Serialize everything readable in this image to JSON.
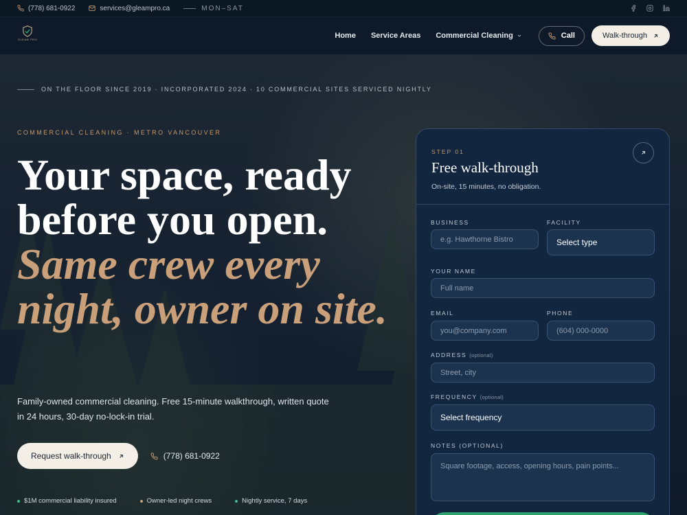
{
  "topbar": {
    "phone": "(778) 681-0922",
    "email": "services@gleampro.ca",
    "hours": "MON–SAT",
    "social_icons": [
      "facebook-icon",
      "instagram-icon",
      "linkedin-icon"
    ]
  },
  "nav": {
    "logo_text": "GLEAM PRO",
    "links": [
      "Home",
      "Service Areas",
      "Commercial Cleaning"
    ],
    "call_label": "Call",
    "walkthrough_label": "Walk-through"
  },
  "hero": {
    "since_line": "ON THE FLOOR SINCE 2019 · INCORPORATED 2024 · 10 COMMERCIAL SITES SERVICED NIGHTLY",
    "eyebrow": "COMMERCIAL CLEANING · METRO VANCOUVER",
    "headline_line1": "Your space, ready",
    "headline_line2": "before you open.",
    "headline_accent": "Same crew every night, owner on site.",
    "lead": "Family-owned commercial cleaning. Free 15-minute walkthrough, written quote in 24 hours, 30-day no-lock-in trial.",
    "cta_label": "Request walk-through",
    "cta_phone": "(778) 681-0922",
    "badges": [
      {
        "text": "$1M commercial liability insured",
        "color": "#3fbf86"
      },
      {
        "text": "Owner-led night crews",
        "color": "#c9a07a"
      },
      {
        "text": "Nightly service, 7 days",
        "color": "#3fbf86"
      }
    ]
  },
  "form": {
    "step": "STEP 01",
    "title": "Free walk-through",
    "subtitle": "On-site, 15 minutes, no obligation.",
    "business_label": "BUSINESS",
    "business_placeholder": "e.g. Hawthorne Bistro",
    "facility_label": "FACILITY",
    "facility_value": "Select type",
    "name_label": "YOUR NAME",
    "name_placeholder": "Full name",
    "email_label": "EMAIL",
    "email_placeholder": "you@company.com",
    "phone_label": "PHONE",
    "phone_placeholder": "(604) 000-0000",
    "address_label": "ADDRESS",
    "address_optional": "(optional)",
    "address_placeholder": "Street, city",
    "frequency_label": "FREQUENCY",
    "frequency_optional": "(optional)",
    "frequency_value": "Select frequency",
    "notes_label": "NOTES (OPTIONAL)",
    "notes_placeholder": "Square footage, access, opening hours, pain points..."
  },
  "colors": {
    "accent_gold": "#c9a07a",
    "cream_button": "#f4efe6",
    "submit_green": "#2fa36f",
    "card_bg": "#132640"
  }
}
